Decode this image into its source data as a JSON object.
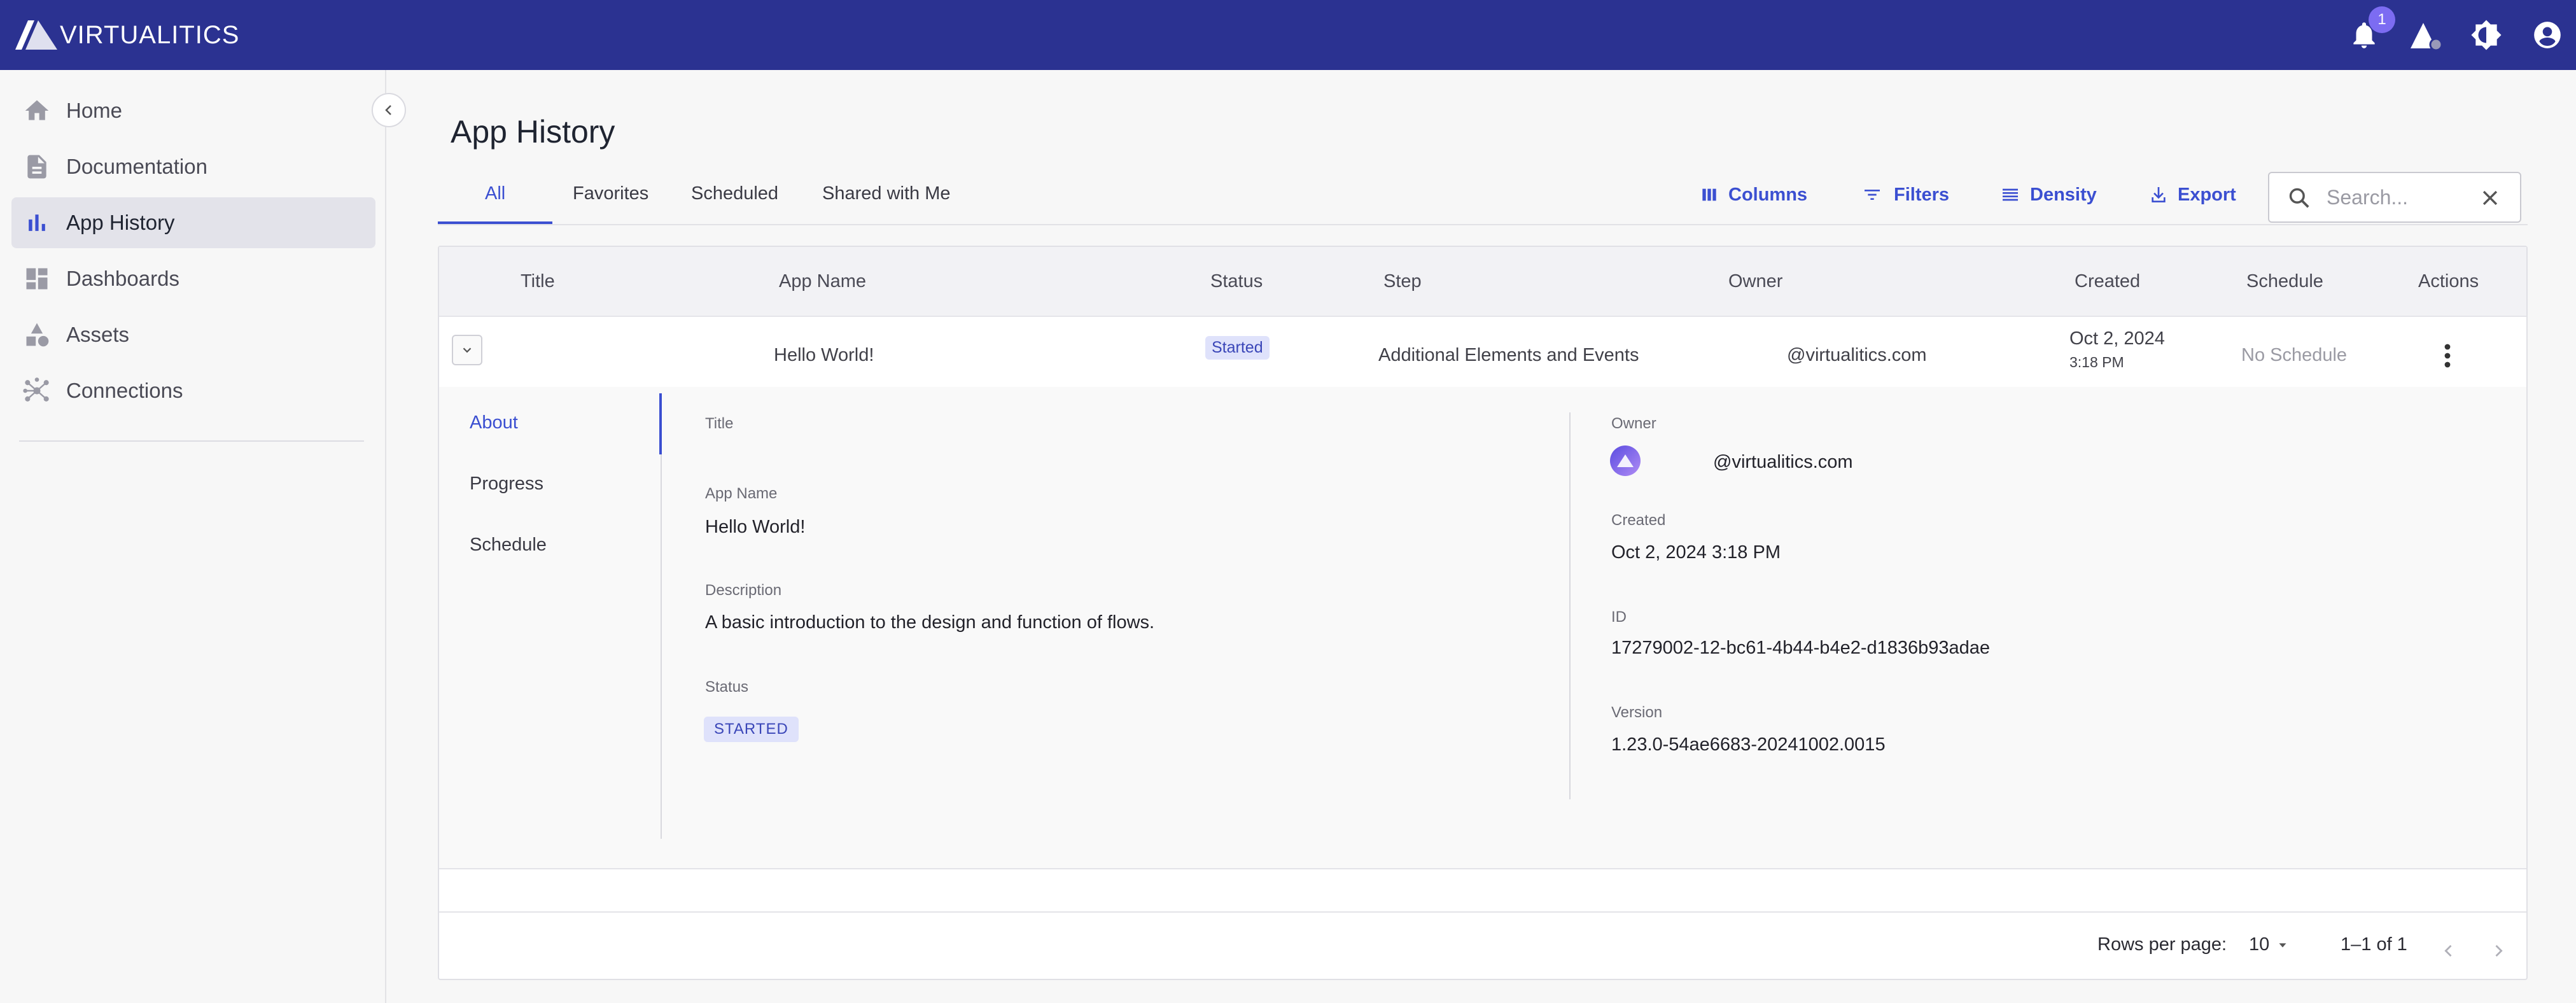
{
  "brand": {
    "name": "VIRTUALITICS"
  },
  "header": {
    "notification_count": "1"
  },
  "sidebar": {
    "items": [
      {
        "label": "Home",
        "icon": "home-icon"
      },
      {
        "label": "Documentation",
        "icon": "document-icon"
      },
      {
        "label": "App History",
        "icon": "bar-chart-icon",
        "active": true
      },
      {
        "label": "Dashboards",
        "icon": "dashboard-icon"
      },
      {
        "label": "Assets",
        "icon": "shapes-icon"
      },
      {
        "label": "Connections",
        "icon": "network-icon"
      }
    ]
  },
  "page": {
    "title": "App History"
  },
  "tabs": [
    {
      "label": "All",
      "active": true
    },
    {
      "label": "Favorites"
    },
    {
      "label": "Scheduled"
    },
    {
      "label": "Shared with Me"
    }
  ],
  "toolbar": {
    "columns_label": "Columns",
    "filters_label": "Filters",
    "density_label": "Density",
    "export_label": "Export",
    "search_placeholder": "Search..."
  },
  "table": {
    "columns": [
      "Title",
      "App Name",
      "Status",
      "Step",
      "Owner",
      "Created",
      "Schedule",
      "Actions"
    ],
    "row": {
      "title": "",
      "app_name": "Hello World!",
      "status": "Started",
      "step": "Additional Elements and Events",
      "owner": "@virtualitics.com",
      "created_date": "Oct 2, 2024",
      "created_time": "3:18 PM",
      "schedule": "No Schedule"
    }
  },
  "detail": {
    "tabs": [
      "About",
      "Progress",
      "Schedule"
    ],
    "title_label": "Title",
    "title_value": "",
    "app_name_label": "App Name",
    "app_name_value": "Hello World!",
    "description_label": "Description",
    "description_value": "A basic introduction to the design and function of flows.",
    "status_label": "Status",
    "status_value": "STARTED",
    "owner_label": "Owner",
    "owner_value": "@virtualitics.com",
    "created_label": "Created",
    "created_value": "Oct 2, 2024 3:18 PM",
    "id_label": "ID",
    "id_value": "17279002-12-bc61-4b44-b4e2-d1836b93adae",
    "version_label": "Version",
    "version_value": "1.23.0-54ae6683-20241002.0015"
  },
  "pagination": {
    "rows_per_page_label": "Rows per page:",
    "rows_per_page_value": "10",
    "range_label": "1–1 of 1"
  },
  "colors": {
    "header_bg": "#2b3291",
    "accent": "#3b4fd1",
    "badge": "#7c6cf2",
    "chip_bg": "#dfe2fb"
  }
}
